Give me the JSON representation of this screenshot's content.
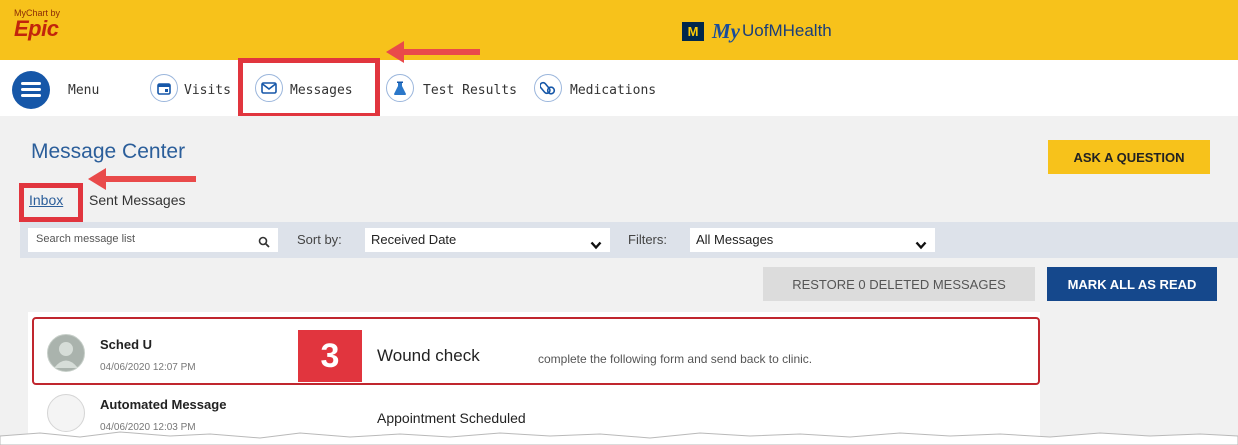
{
  "header": {
    "epic_small": "MyChart by",
    "epic_big": "Epic",
    "brand_block": "M",
    "brand_my": "My",
    "brand_name": "UofMHealth"
  },
  "nav": {
    "menu_label": "Menu",
    "items": [
      {
        "label": "Visits",
        "icon": "calendar-icon"
      },
      {
        "label": "Messages",
        "icon": "envelope-icon"
      },
      {
        "label": "Test Results",
        "icon": "flask-icon"
      },
      {
        "label": "Medications",
        "icon": "pills-icon"
      }
    ]
  },
  "page": {
    "title": "Message Center",
    "ask_button": "ASK A QUESTION"
  },
  "tabs": [
    "Inbox",
    "Sent Messages"
  ],
  "filters": {
    "search_placeholder": "Search message list",
    "sort_label": "Sort by:",
    "sort_value": "Received Date",
    "filter_label": "Filters:",
    "filter_value": "All Messages"
  },
  "actions": {
    "restore": "RESTORE 0 DELETED MESSAGES",
    "mark_all": "MARK ALL AS READ"
  },
  "messages": [
    {
      "sender": "Sched U",
      "date": "04/06/2020 12:07 PM",
      "subject": "Wound check",
      "preview": "complete the following form and send back to clinic."
    },
    {
      "sender": "Automated Message",
      "date": "04/06/2020 12:03 PM",
      "subject": "Appointment Scheduled",
      "preview": ""
    }
  ],
  "annotation": {
    "step_number": "3"
  },
  "colors": {
    "brand_yellow": "#F7C21B",
    "primary_blue": "#15488c",
    "highlight_red": "#e1353e"
  }
}
